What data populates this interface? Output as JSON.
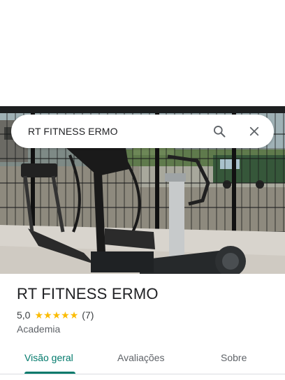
{
  "search": {
    "query": "RT FITNESS ERMO"
  },
  "place": {
    "name": "RT FITNESS ERMO",
    "rating": "5,0",
    "stars": [
      "★",
      "★",
      "★",
      "★",
      "★"
    ],
    "review_count": "(7)",
    "category": "Academia"
  },
  "tabs": [
    {
      "label": "Visão geral",
      "active": true
    },
    {
      "label": "Avaliações",
      "active": false
    },
    {
      "label": "Sobre",
      "active": false
    }
  ],
  "colors": {
    "accent": "#00796b",
    "star": "#fbbc04"
  },
  "icons": {
    "search": "search-icon",
    "close": "close-icon"
  }
}
